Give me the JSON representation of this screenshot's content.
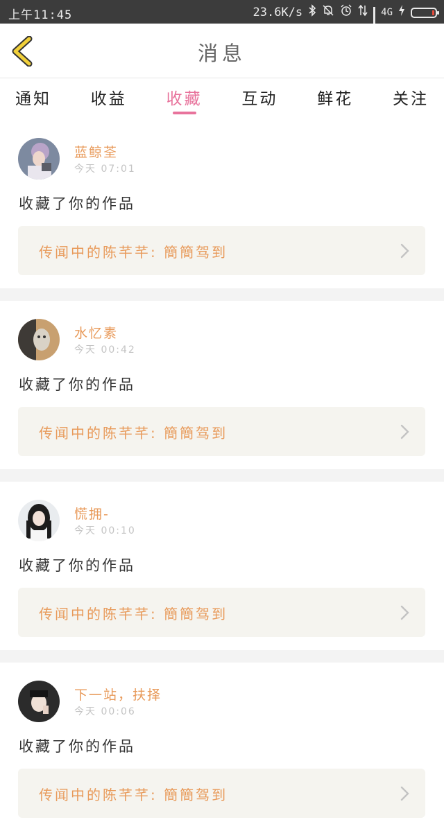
{
  "status_bar": {
    "time": "上午11:45",
    "network_speed": "23.6K/s",
    "network_type": "4G",
    "icons": [
      "bluetooth-icon",
      "mute-bell-icon",
      "alarm-icon",
      "data-arrows-icon",
      "signal-icon",
      "charging-icon",
      "battery-icon"
    ]
  },
  "header": {
    "title": "消息"
  },
  "tabs": [
    {
      "label": "通知",
      "active": false
    },
    {
      "label": "收益",
      "active": false
    },
    {
      "label": "收藏",
      "active": true
    },
    {
      "label": "互动",
      "active": false
    },
    {
      "label": "鲜花",
      "active": false
    },
    {
      "label": "关注",
      "active": false
    }
  ],
  "colors": {
    "accent_pink": "#e8739c",
    "accent_orange": "#e89a5a",
    "back_arrow": "#f1d03a"
  },
  "messages": [
    {
      "username": "蓝鲸荃",
      "time": "今天 07:01",
      "action": "收藏了你的作品",
      "work": "传闻中的陈芊芊: 簡簡驾到"
    },
    {
      "username": "水忆素",
      "time": "今天 00:42",
      "action": "收藏了你的作品",
      "work": "传闻中的陈芊芊: 簡簡驾到"
    },
    {
      "username": "慌拥-",
      "time": "今天 00:10",
      "action": "收藏了你的作品",
      "work": "传闻中的陈芊芊: 簡簡驾到"
    },
    {
      "username": "下一站，扶择",
      "time": "今天 00:06",
      "action": "收藏了你的作品",
      "work": "传闻中的陈芊芊: 簡簡驾到"
    }
  ]
}
